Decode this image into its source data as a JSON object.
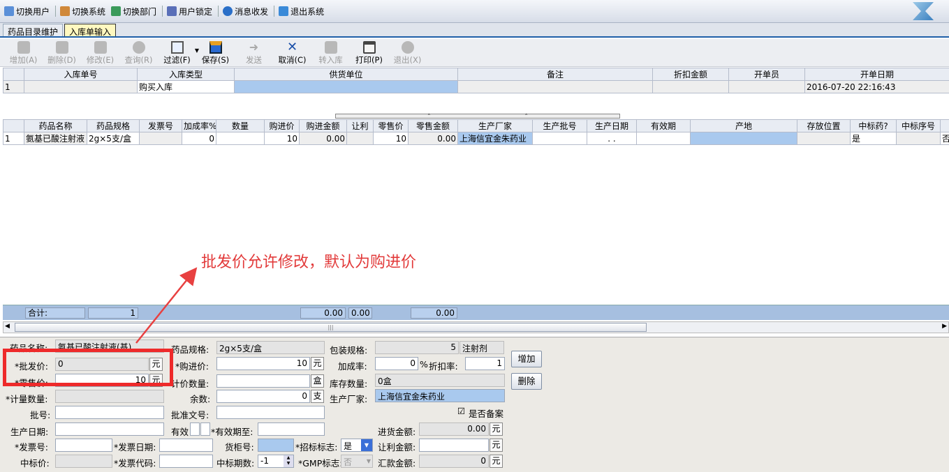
{
  "topbar": {
    "items": [
      {
        "label": "切换用户",
        "icon": "users-icon",
        "color": "#5a8fd8"
      },
      {
        "label": "切换系统",
        "icon": "system-icon",
        "color": "#d0883a"
      },
      {
        "label": "切换部门",
        "icon": "department-icon",
        "color": "#3a9a5a"
      },
      {
        "label": "用户锁定",
        "icon": "lock-icon",
        "color": "#5a6fb8"
      },
      {
        "label": "消息收发",
        "icon": "info-icon",
        "color": "#2a6fc8"
      },
      {
        "label": "退出系统",
        "icon": "exit-icon",
        "color": "#3a8ad8"
      }
    ]
  },
  "tabs": [
    {
      "label": "药品目录维护",
      "active": false
    },
    {
      "label": "入库单输入",
      "active": true
    }
  ],
  "toolbar": [
    {
      "label": "增加(A)",
      "enabled": false
    },
    {
      "label": "删除(D)",
      "enabled": false
    },
    {
      "label": "修改(E)",
      "enabled": false
    },
    {
      "label": "查询(R)",
      "enabled": false
    },
    {
      "label": "过滤(F)",
      "enabled": true,
      "dropdown": true
    },
    {
      "label": "保存(S)",
      "enabled": true
    },
    {
      "label": "发送",
      "enabled": false
    },
    {
      "label": "取消(C)",
      "enabled": true
    },
    {
      "label": "转入库",
      "enabled": false
    },
    {
      "label": "打印(P)",
      "enabled": true
    },
    {
      "label": "退出(X)",
      "enabled": false
    }
  ],
  "order_grid": {
    "columns": [
      "",
      "入库单号",
      "入库类型",
      "供货单位",
      "备注",
      "折扣金额",
      "开单员",
      "开单日期"
    ],
    "rows": [
      [
        "1",
        "",
        "购买入库",
        "",
        "",
        "",
        "",
        "2016-07-20 22:16:43"
      ]
    ]
  },
  "detail_grid": {
    "columns": [
      "",
      "药品名称",
      "药品规格",
      "发票号",
      "加成率%",
      "数量",
      "购进价",
      "购进金额",
      "让利",
      "零售价",
      "零售金额",
      "生产厂家",
      "生产批号",
      "生产日期",
      "有效期",
      "产地",
      "存放位置",
      "中标药?",
      "中标序号",
      ""
    ],
    "rows": [
      [
        "1",
        "氨基已酸注射液",
        "2g×5支/盒",
        "",
        "0",
        "",
        "10",
        "0.00",
        "",
        "10",
        "0.00",
        "上海信宜金朱药业",
        "",
        "  .  .",
        "",
        "",
        "",
        "是",
        "",
        "否"
      ]
    ]
  },
  "summary": {
    "label": "合计:",
    "count": "1",
    "amount1": "0.00",
    "amount2": "0.00",
    "amount3": "0.00"
  },
  "form": {
    "drug_name_label": "药品名称:",
    "drug_name": "氨基已酸注射液(基)",
    "spec_label": "药品规格:",
    "spec": "2g×5支/盒",
    "pack_label": "包装规格:",
    "pack_qty": "5",
    "pack_type": "注射剂",
    "wholesale_label": "*批发价:",
    "wholesale": "0",
    "unit_yuan": "元",
    "purchase_label": "*购进价:",
    "purchase": "10",
    "markup_label": "加成率:",
    "markup": "0",
    "percent": "%",
    "discount_label": "折扣率:",
    "discount": "1",
    "retail_label": "*零售价:",
    "retail": "10",
    "price_qty_label": "计价数量:",
    "unit_box": "盒",
    "stock_label": "库存数量:",
    "stock": "0盒",
    "measure_label": "*计量数量:",
    "remain_label": "余数:",
    "remain": "0",
    "unit_zhi": "支",
    "maker_label": "生产厂家:",
    "maker": "上海信宜金朱药业",
    "record_label": "是否备案",
    "record_checked": "☑",
    "batch_label": "批号:",
    "approval_label": "批准文号:",
    "prod_date_label": "生产日期:",
    "valid_label": "有效",
    "valid_until_label": "*有效期至:",
    "purchase_amt_label": "进货金额:",
    "purchase_amt": "0.00",
    "invoice_label": "*发票号:",
    "invoice_date_label": "*发票日期:",
    "cabinet_label": "货柜号:",
    "tender_flag_label": "*招标标志:",
    "tender_flag": "是",
    "rebate_label": "让利金额:",
    "bid_price_label": "中标价:",
    "invoice_code_label": "*发票代码:",
    "bid_period_label": "中标期数:",
    "bid_period": "-1",
    "gmp_label": "*GMP标志:",
    "gmp": "否",
    "total_label": "汇款金额:",
    "total": "0",
    "add_button": "增加",
    "delete_button": "删除"
  },
  "annotation": {
    "text": "批发价允许修改，默认为购进价",
    "color": "#e23a3a"
  }
}
